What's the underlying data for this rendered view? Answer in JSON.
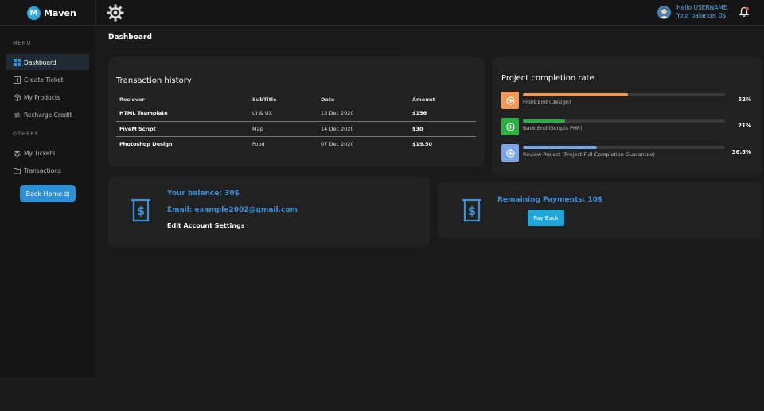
{
  "brand": {
    "name": "Maven",
    "badge": "M"
  },
  "user": {
    "greeting": "Hello USERNAME,",
    "balance": "Your balance: 0$"
  },
  "sidebar": {
    "menu_heading": "MENU",
    "menu_items": [
      {
        "label": "Dashboard",
        "icon": "grid-icon"
      },
      {
        "label": "Create Ticket",
        "icon": "plus-square-icon"
      },
      {
        "label": "My Products",
        "icon": "box-icon"
      },
      {
        "label": "Recharge Credit",
        "icon": "refresh-icon"
      }
    ],
    "others_heading": "OTHERS",
    "other_items": [
      {
        "label": "My Tickets",
        "icon": "layers-icon"
      },
      {
        "label": "Transactions",
        "icon": "folder-icon"
      }
    ],
    "back_button": "Back Home ⊞"
  },
  "page": {
    "title": "Dashboard"
  },
  "transactions": {
    "title": "Transaction history",
    "columns": [
      "Reciever",
      "SubTitle",
      "Date",
      "Amount"
    ],
    "rows": [
      [
        "HTML Teamplate",
        "UI & UX",
        "13 Dec 2020",
        "$156"
      ],
      [
        "FiveM Script",
        "Map",
        "14 Dec 2020",
        "$30"
      ],
      [
        "Photoshop Design",
        "Food",
        "07 Dec 2020",
        "$19.50"
      ]
    ]
  },
  "projects": {
    "title": "Project completion rate",
    "items": [
      {
        "label": "Front End (Design)",
        "percent_text": "52%",
        "value": 52,
        "color": "#f29a55"
      },
      {
        "label": "Back End (Scripts PHP)",
        "percent_text": "21%",
        "value": 21,
        "color": "#2fae45"
      },
      {
        "label": "Review Project (Project Full Completion Guarantee)",
        "percent_text": "36.5%",
        "value": 36.5,
        "color": "#7ba5e6"
      }
    ]
  },
  "balance_card": {
    "balance": "Your balance: 30$",
    "email": "Email: example2002@gmail.com",
    "edit_link": "Edit Account Settings"
  },
  "payments_card": {
    "remaining": "Remaining Payments: 10$",
    "pay_button": "Pay Back"
  },
  "colors": {
    "accent": "#3d8fd8",
    "button": "#2d8fd4",
    "background": "#1a1a1a",
    "card": "#212121"
  }
}
